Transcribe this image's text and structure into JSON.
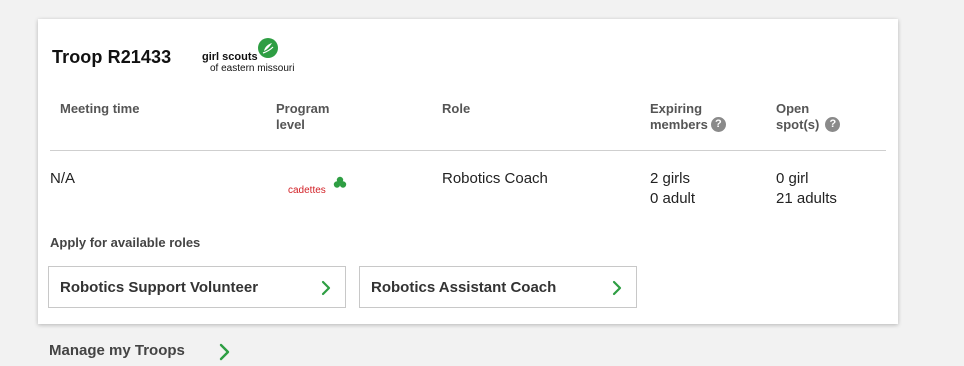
{
  "troop": {
    "title": "Troop R21433",
    "council_logo": {
      "line1": "girl scouts",
      "line2": "of eastern missouri",
      "brand_color": "#2e9e43"
    }
  },
  "table": {
    "headers": {
      "meeting_time": "Meeting time",
      "program_level_1": "Program",
      "program_level_2": "level",
      "role": "Role",
      "expiring_1": "Expiring",
      "expiring_2": "members",
      "open_1": "Open",
      "open_2": "spot(s)"
    },
    "help_icon_glyph": "?",
    "row": {
      "meeting_time": "N/A",
      "program_level_logo": "cadettes",
      "program_level_color": "#d21f25",
      "role": "Robotics Coach",
      "expiring_girls": "2 girls",
      "expiring_adults": "0 adult",
      "open_girls": "0 girl",
      "open_adults": "21 adults"
    }
  },
  "apply": {
    "label": "Apply for available roles",
    "roles": [
      "Robotics Support Volunteer",
      "Robotics Assistant Coach"
    ]
  },
  "manage": {
    "label": "Manage my Troops"
  },
  "colors": {
    "accent_green": "#2e9e43",
    "background": "#f2f2f2",
    "card": "#ffffff"
  }
}
